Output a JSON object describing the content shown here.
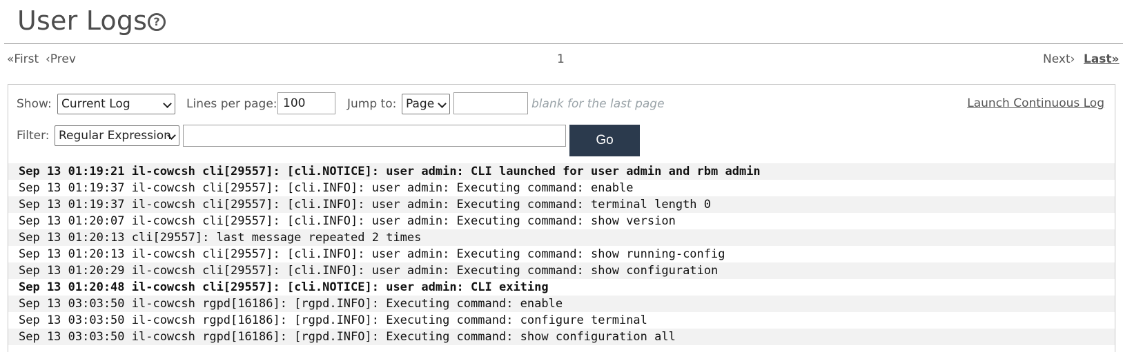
{
  "page": {
    "title": "User Logs",
    "help_icon": "question-circle-icon"
  },
  "pager": {
    "first": "«First",
    "prev": "‹Prev",
    "current_page": "1",
    "next": "Next›",
    "last": "Last»"
  },
  "controls": {
    "show_label": "Show:",
    "show_value": "Current Log",
    "lines_label": "Lines per page:",
    "lines_value": "100",
    "jump_label": "Jump to:",
    "jump_type_value": "Page",
    "jump_hint": "blank for the last page",
    "launch_link": "Launch Continuous Log",
    "filter_label": "Filter:",
    "filter_type_value": "Regular Expression",
    "filter_value": "",
    "go_label": "Go"
  },
  "logs": [
    {
      "text": "Sep 13 01:19:21 il-cowcsh cli[29557]: [cli.NOTICE]: user admin: CLI launched for user admin and rbm admin",
      "bold": true
    },
    {
      "text": "Sep 13 01:19:37 il-cowcsh cli[29557]: [cli.INFO]: user admin: Executing command: enable",
      "bold": false
    },
    {
      "text": "Sep 13 01:19:37 il-cowcsh cli[29557]: [cli.INFO]: user admin: Executing command: terminal length 0",
      "bold": false
    },
    {
      "text": "Sep 13 01:20:07 il-cowcsh cli[29557]: [cli.INFO]: user admin: Executing command: show version",
      "bold": false
    },
    {
      "text": "Sep 13 01:20:13 cli[29557]: last message repeated 2 times",
      "bold": false
    },
    {
      "text": "Sep 13 01:20:13 il-cowcsh cli[29557]: [cli.INFO]: user admin: Executing command: show running-config",
      "bold": false
    },
    {
      "text": "Sep 13 01:20:29 il-cowcsh cli[29557]: [cli.INFO]: user admin: Executing command: show configuration",
      "bold": false
    },
    {
      "text": "Sep 13 01:20:48 il-cowcsh cli[29557]: [cli.NOTICE]: user admin: CLI exiting",
      "bold": true
    },
    {
      "text": "Sep 13 03:03:50 il-cowcsh rgpd[16186]: [rgpd.INFO]: Executing command: enable",
      "bold": false
    },
    {
      "text": "Sep 13 03:03:50 il-cowcsh rgpd[16186]: [rgpd.INFO]: Executing command: configure terminal",
      "bold": false
    },
    {
      "text": "Sep 13 03:03:50 il-cowcsh rgpd[16186]: [rgpd.INFO]: Executing command: show configuration all",
      "bold": false
    }
  ]
}
